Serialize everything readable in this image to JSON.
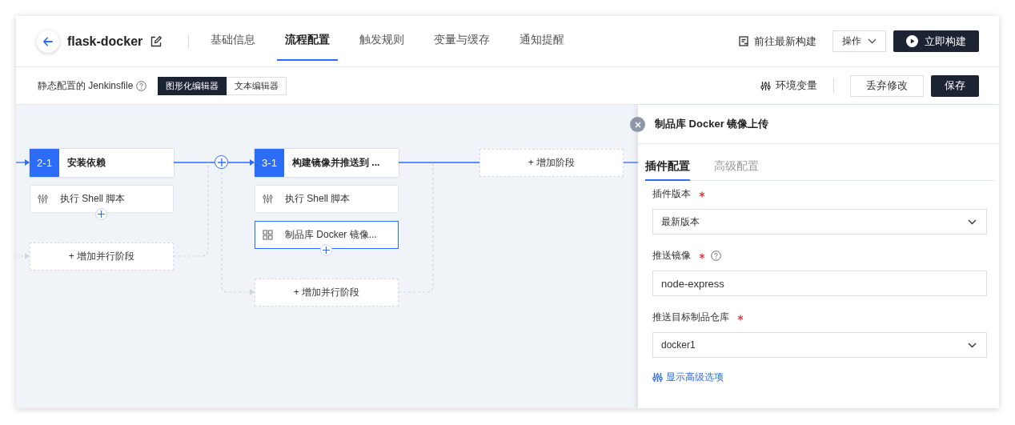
{
  "header": {
    "title": "flask-docker",
    "tabs": [
      {
        "label": "基础信息",
        "selected": false
      },
      {
        "label": "流程配置",
        "selected": true
      },
      {
        "label": "触发规则",
        "selected": false
      },
      {
        "label": "变量与缓存",
        "selected": false
      },
      {
        "label": "通知提醒",
        "selected": false
      }
    ],
    "latest_build_link": "前往最新构建",
    "actions_menu": "操作",
    "run_button": "立即构建"
  },
  "toolbar": {
    "label": "静态配置的 Jenkinsfile",
    "editor_modes": [
      {
        "label": "图形化编辑器",
        "selected": true
      },
      {
        "label": "文本编辑器",
        "selected": false
      }
    ],
    "env_vars": "环境变量",
    "discard_button": "丢弃修改",
    "save_button": "保存"
  },
  "pipeline": {
    "stages": [
      {
        "number": "2-1",
        "name": "安装依赖",
        "tasks": [
          {
            "kind": "shell",
            "label": "执行 Shell 脚本",
            "selected": false
          }
        ],
        "add_parallel": "+ 增加并行阶段"
      },
      {
        "number": "3-1",
        "name": "构建镜像并推送到 ...",
        "tasks": [
          {
            "kind": "shell",
            "label": "执行 Shell 脚本",
            "selected": false
          },
          {
            "kind": "plugin",
            "label": "制品库 Docker 镜像...",
            "selected": true
          }
        ],
        "add_parallel": "+ 增加并行阶段"
      }
    ],
    "add_stage": "+ 增加阶段"
  },
  "panel": {
    "title": "制品库 Docker 镜像上传",
    "tabs": [
      {
        "label": "插件配置",
        "selected": true
      },
      {
        "label": "高级配置",
        "selected": false
      }
    ],
    "fields": [
      {
        "kind": "select",
        "label": "插件版本",
        "required": true,
        "help": false,
        "value": "最新版本"
      },
      {
        "kind": "input",
        "label": "推送镜像",
        "required": true,
        "help": true,
        "value": "node-express"
      },
      {
        "kind": "select",
        "label": "推送目标制品仓库",
        "required": true,
        "help": false,
        "value": "docker1"
      }
    ],
    "advanced_link": "显示高级选项"
  }
}
